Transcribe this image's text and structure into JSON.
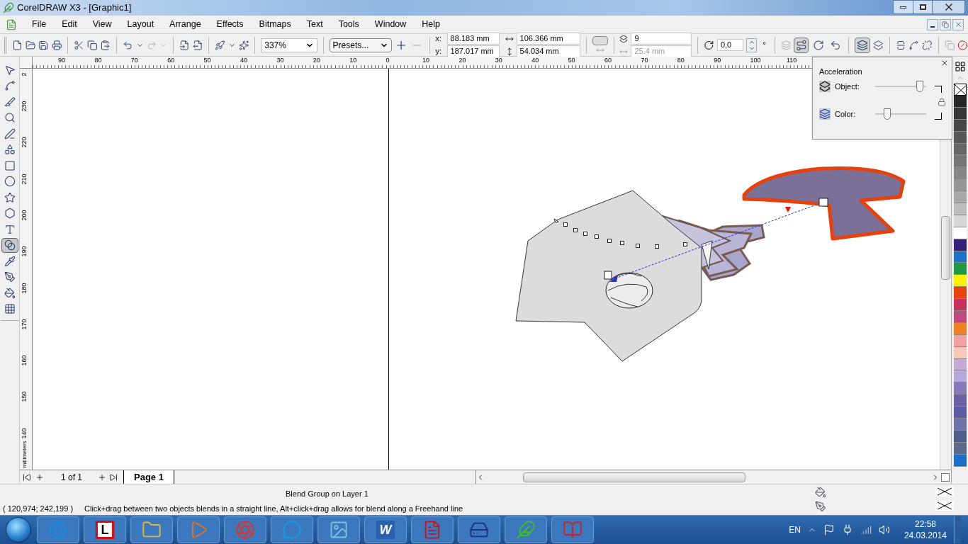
{
  "window": {
    "title": "CorelDRAW X3 - [Graphic1]"
  },
  "menu": [
    "File",
    "Edit",
    "View",
    "Layout",
    "Arrange",
    "Effects",
    "Bitmaps",
    "Text",
    "Tools",
    "Window",
    "Help"
  ],
  "toolbar": {
    "zoom": "337%",
    "presets": "Presets...",
    "x_label": "x:",
    "x": "88.183 mm",
    "y_label": "y:",
    "y": "187.017 mm",
    "width": "106.366 mm",
    "height": "54.034 mm",
    "steps": "9",
    "spacing": "25.4 mm",
    "spacing_disabled": true,
    "rotation": "0,0",
    "degree": "°",
    "direction_buttons": [
      {
        "selected": true
      },
      {
        "selected": false
      },
      {
        "selected": false
      }
    ],
    "acceleration_button": {
      "selected": true
    }
  },
  "tools": [
    {
      "selected": false
    },
    {
      "selected": false
    },
    {
      "selected": false
    },
    {
      "selected": false
    },
    {
      "selected": false
    },
    {
      "selected": false
    },
    {
      "selected": false
    },
    {
      "selected": false
    },
    {
      "selected": false
    },
    {
      "selected": false
    },
    {
      "selected": false
    },
    {
      "selected": true
    },
    {
      "selected": false
    },
    {
      "selected": false
    },
    {
      "selected": false
    },
    {
      "selected": false
    }
  ],
  "rulers": {
    "horizontal": [
      "90",
      "80",
      "70",
      "60",
      "50",
      "40",
      "30",
      "20",
      "10",
      "0",
      "10",
      "20",
      "30",
      "40",
      "50",
      "60",
      "70",
      "80",
      "90",
      "100",
      "110"
    ],
    "vertical": [
      "2",
      "230",
      "220",
      "210",
      "200",
      "190",
      "180",
      "170",
      "160",
      "150",
      "140"
    ],
    "unit": "millimeters"
  },
  "acceleration": {
    "title": "Acceleration",
    "rows": [
      {
        "label": "Object:",
        "level": 0.93
      },
      {
        "label": "Color:",
        "level": 0.2
      }
    ]
  },
  "palette": [
    {
      "color": "#262626"
    },
    {
      "color": "#363636"
    },
    {
      "color": "#464646"
    },
    {
      "color": "#565656"
    },
    {
      "color": "#666666"
    },
    {
      "color": "#767676"
    },
    {
      "color": "#868686"
    },
    {
      "color": "#969696"
    },
    {
      "color": "#a8a8a8"
    },
    {
      "color": "#bdbdbd"
    },
    {
      "color": "#d6d6d6"
    },
    {
      "color": "#ffffff"
    },
    {
      "color": "#33207a"
    },
    {
      "color": "#1c72c8"
    },
    {
      "color": "#1e9a40"
    },
    {
      "color": "#fff000"
    },
    {
      "color": "#e8430a"
    },
    {
      "color": "#c8305c"
    },
    {
      "color": "#c04a80"
    },
    {
      "color": "#f08020"
    },
    {
      "color": "#f4a0a0"
    },
    {
      "color": "#f8c8b4"
    },
    {
      "color": "#c8a8d8"
    },
    {
      "color": "#b4a8dc"
    },
    {
      "color": "#8878bc"
    },
    {
      "color": "#6a60a4"
    },
    {
      "color": "#5c5ca4"
    },
    {
      "color": "#6c72aa"
    },
    {
      "color": "#4c5c8c"
    },
    {
      "color": "#5a6a8c"
    },
    {
      "color": "#1a70c8"
    }
  ],
  "pages": {
    "counter": "1 of 1",
    "tabs": [
      {
        "label": "Page 1",
        "selected": true
      }
    ]
  },
  "status": {
    "object": "Blend Group on Layer 1",
    "coordinates": "( 120,974; 242,199 )",
    "hint": "Click+drag between two objects blends in a straight line, Alt+click+drag allows for blend along a Freehand line"
  },
  "taskbar": {
    "apps": [
      {
        "kind": "browser"
      },
      {
        "kind": "dictionary",
        "glyph": "L"
      },
      {
        "kind": "folder"
      },
      {
        "kind": "media"
      },
      {
        "kind": "chrome"
      },
      {
        "kind": "chat"
      },
      {
        "kind": "photo"
      },
      {
        "kind": "word",
        "glyph": "W"
      },
      {
        "kind": "pdf"
      },
      {
        "kind": "floppy"
      },
      {
        "kind": "corel"
      },
      {
        "kind": "books"
      }
    ],
    "language": "EN",
    "time": "22:58",
    "date": "24.03.2014"
  }
}
